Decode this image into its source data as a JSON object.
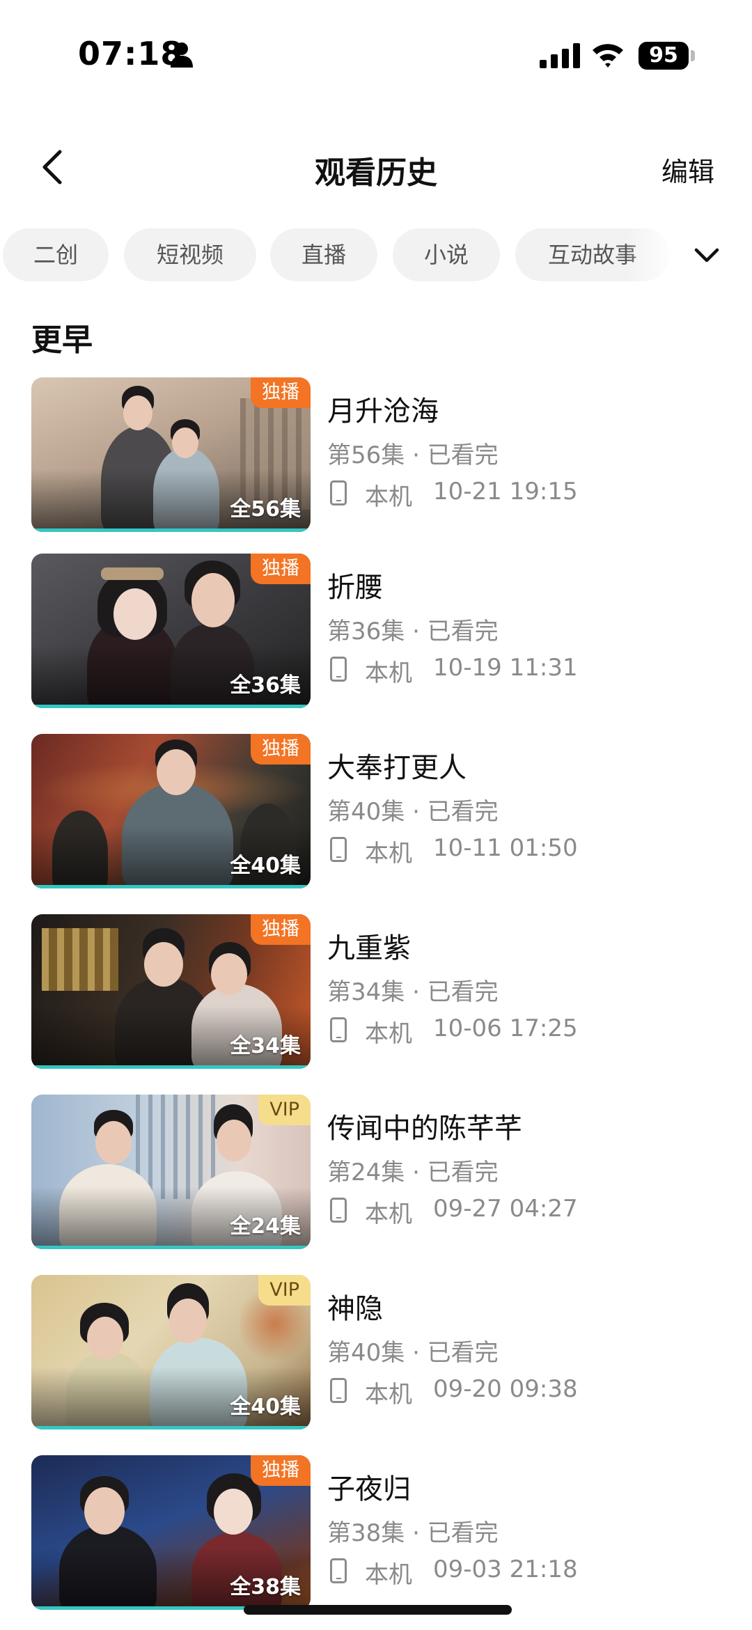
{
  "status_bar": {
    "time": "07:18",
    "battery": "95"
  },
  "header": {
    "title": "观看历史",
    "edit_label": "编辑"
  },
  "filters": [
    "二创",
    "短视频",
    "直播",
    "小说",
    "互动故事"
  ],
  "section_title": "更早",
  "history": [
    {
      "title": "月升沧海",
      "progress": "第56集 · 已看完",
      "device": "本机",
      "time": "10-21 19:15",
      "badge": "独播",
      "badge_type": "exclusive",
      "total": "全56集"
    },
    {
      "title": "折腰",
      "progress": "第36集 · 已看完",
      "device": "本机",
      "time": "10-19 11:31",
      "badge": "独播",
      "badge_type": "exclusive",
      "total": "全36集"
    },
    {
      "title": "大奉打更人",
      "progress": "第40集 · 已看完",
      "device": "本机",
      "time": "10-11 01:50",
      "badge": "独播",
      "badge_type": "exclusive",
      "total": "全40集"
    },
    {
      "title": "九重紫",
      "progress": "第34集 · 已看完",
      "device": "本机",
      "time": "10-06 17:25",
      "badge": "独播",
      "badge_type": "exclusive",
      "total": "全34集"
    },
    {
      "title": "传闻中的陈芊芊",
      "progress": "第24集 · 已看完",
      "device": "本机",
      "time": "09-27 04:27",
      "badge": "VIP",
      "badge_type": "vip",
      "total": "全24集"
    },
    {
      "title": "神隐",
      "progress": "第40集 · 已看完",
      "device": "本机",
      "time": "09-20 09:38",
      "badge": "VIP",
      "badge_type": "vip",
      "total": "全40集"
    },
    {
      "title": "子夜归",
      "progress": "第38集 · 已看完",
      "device": "本机",
      "time": "09-03 21:18",
      "badge": "独播",
      "badge_type": "exclusive",
      "total": "全38集"
    }
  ],
  "colors": {
    "exclusive_badge": "#f27424",
    "vip_badge": "#f6dd8c",
    "progress_bar": "#35c6c2",
    "secondary_text": "#8a8a8a"
  }
}
